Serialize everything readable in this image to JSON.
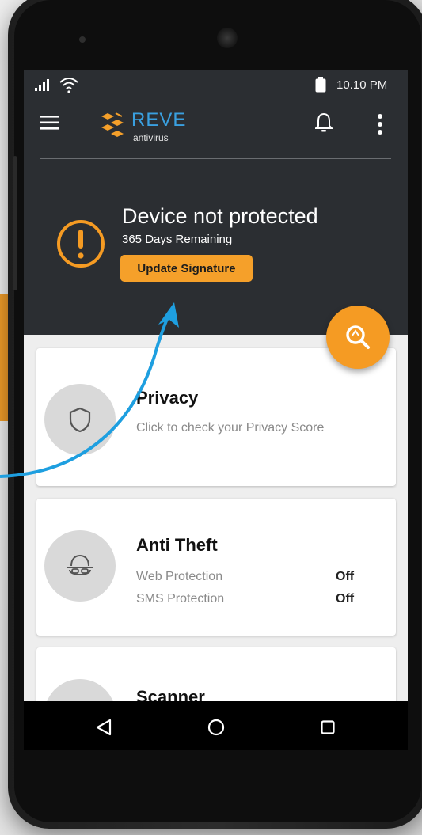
{
  "status_bar": {
    "time": "10.10 PM"
  },
  "app_bar": {
    "brand_name": "REVE",
    "brand_sub": "antivirus"
  },
  "protection": {
    "title": "Device not protected",
    "days_remaining": "365 Days Remaining",
    "update_button": "Update Signature",
    "status_color": "#f5a02a"
  },
  "cards": {
    "privacy": {
      "title": "Privacy",
      "subtitle": "Click to check your Privacy Score"
    },
    "anti_theft": {
      "title": "Anti Theft",
      "rows": [
        {
          "label": "Web Protection",
          "value": "Off"
        },
        {
          "label": "SMS Protection",
          "value": "Off"
        }
      ]
    },
    "scanner": {
      "title": "Scanner"
    }
  },
  "icons": {
    "status": [
      "signal-icon",
      "wifi-icon",
      "battery-icon"
    ],
    "app_bar": [
      "menu-icon",
      "reve-logo",
      "bell-icon",
      "more-icon"
    ],
    "nav": [
      "back-icon",
      "home-icon",
      "recent-apps-icon"
    ]
  },
  "colors": {
    "header_bg": "#2b2e32",
    "accent_orange": "#f59b23",
    "brand_blue": "#3aa0e0",
    "annotation_blue": "#1e9fe0"
  }
}
